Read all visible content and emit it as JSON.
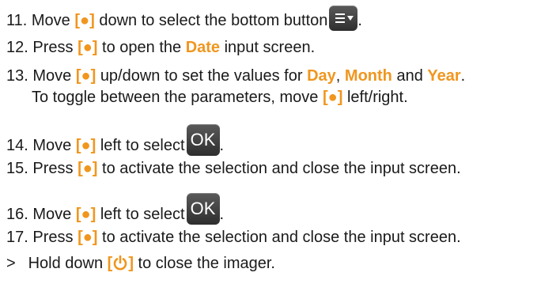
{
  "colors": {
    "accent": "#f0961e",
    "text": "#1a1a1a"
  },
  "key": "[●]",
  "steps": [
    {
      "num": "11.",
      "t1": "Move",
      "t2": "down to select the bottom button",
      "t3": "."
    },
    {
      "num": "12.",
      "t1": "Press",
      "t2": "to open the",
      "kw": "Date",
      "t3": "input screen."
    },
    {
      "num": "13.",
      "t1": "Move",
      "t2": "up/down to set the values for",
      "kw1": "Day",
      "sep": ",",
      "kw2": "Month",
      "and": "and",
      "kw3": "Year",
      "end": "."
    },
    {
      "cont": "To toggle between the parameters, move",
      "tail": "left/right."
    },
    {
      "num": "14.",
      "t1": "Move",
      "t2": "left to select",
      "t3": "."
    },
    {
      "num": "15.",
      "t1": "Press",
      "t2": "to activate the selection and close the input screen."
    },
    {
      "num": "16.",
      "t1": "Move",
      "t2": "left to select",
      "t3": "."
    },
    {
      "num": "17.",
      "t1": "Press",
      "t2": "to activate the selection and close the input screen."
    },
    {
      "num": ">",
      "t1": "Hold down",
      "t2": "to close the imager."
    }
  ],
  "ok_label": "OK",
  "icons": {
    "menu": "menu-dropdown-icon",
    "power": "power-icon"
  }
}
